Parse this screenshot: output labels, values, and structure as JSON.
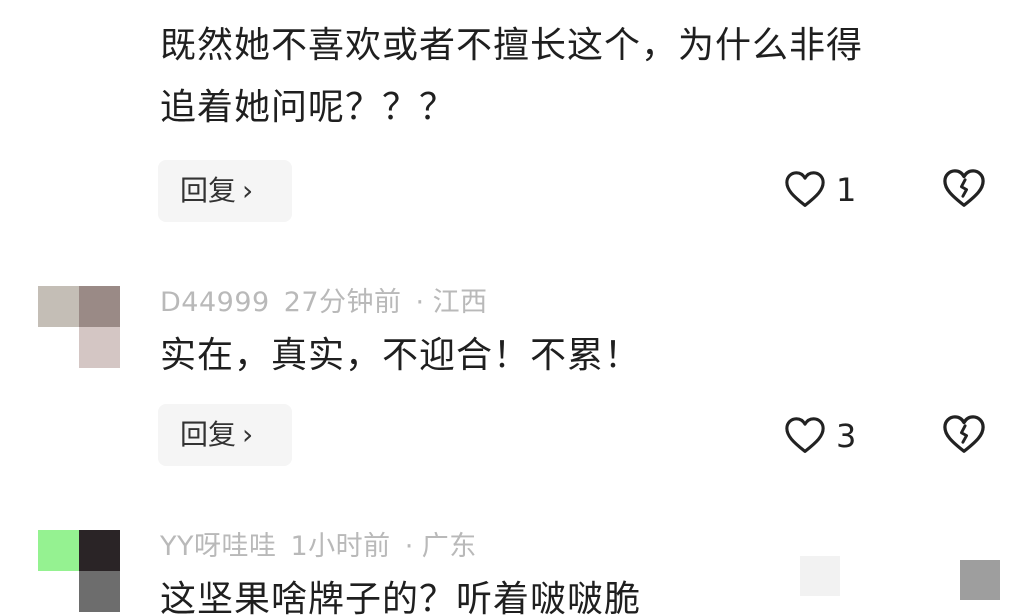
{
  "comments": [
    {
      "avatar_colors": [
        "#e9ddd6",
        "#b88c8c",
        "#ffffff",
        "#ffffff"
      ],
      "text_lines": [
        "既然她不喜欢或者不擅长这个，为什么非得",
        "追着她问呢？？？"
      ],
      "reply_label": "回复",
      "likes": "1"
    },
    {
      "username": "D44999",
      "time": "27分钟前",
      "location": "江西",
      "avatar_colors": [
        "#c4beb6",
        "#9a8a86",
        "#ffffff",
        "#d4c6c4"
      ],
      "text_lines": [
        "实在，真实，不迎合！不累！"
      ],
      "reply_label": "回复",
      "likes": "3"
    },
    {
      "username": "YY呀哇哇",
      "time": "1小时前",
      "location": "广东",
      "avatar_colors": [
        "#95f291",
        "#2a2426",
        "#ffffff",
        "#6d6d6d"
      ],
      "text_lines": [
        "这坚果啥牌子的？听着啵啵脆"
      ]
    }
  ],
  "separator": "·",
  "icons": {
    "like": "heart-outline-icon",
    "dislike": "broken-heart-icon",
    "reply_chevron": "chevron-right-icon"
  }
}
